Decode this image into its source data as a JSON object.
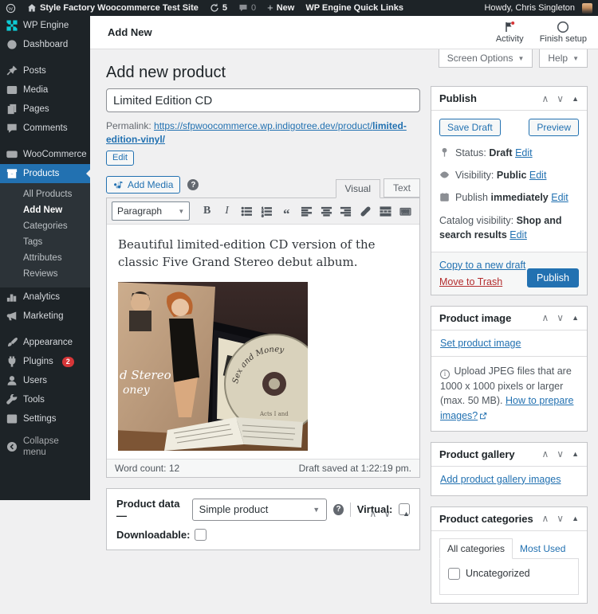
{
  "colors": {
    "accent": "#2271b1",
    "admin_bar_bg": "#1d2327",
    "badge_red": "#d63638",
    "danger_red": "#b32d2e",
    "wpengine_teal": "#0ecad4",
    "page_bg": "#f0f0f1"
  },
  "admin_bar": {
    "site_name": "Style Factory Woocommerce Test Site",
    "updates_count": "5",
    "comments_count": "0",
    "new_label": "New",
    "quick_links_label": "WP Engine Quick Links",
    "howdy_text": "Howdy, Chris Singleton"
  },
  "sidebar": {
    "wp_engine": "WP Engine",
    "dashboard": "Dashboard",
    "posts": "Posts",
    "media": "Media",
    "pages": "Pages",
    "comments": "Comments",
    "woocommerce": "WooCommerce",
    "products": "Products",
    "submenu": [
      "All Products",
      "Add New",
      "Categories",
      "Tags",
      "Attributes",
      "Reviews"
    ],
    "analytics": "Analytics",
    "marketing": "Marketing",
    "appearance": "Appearance",
    "plugins": "Plugins",
    "plugins_badge": "2",
    "users": "Users",
    "tools": "Tools",
    "settings": "Settings",
    "collapse": "Collapse menu"
  },
  "header": {
    "page_title": "Add New",
    "activity_label": "Activity",
    "finish_setup_label": "Finish setup",
    "screen_options_label": "Screen Options",
    "help_label": "Help"
  },
  "main": {
    "heading": "Add new product",
    "title_value": "Limited Edition CD",
    "permalink": {
      "label": "Permalink:",
      "url_base": "https://sfpwoocommerce.wp.indigotree.dev/product/",
      "slug": "limited-edition-vinyl/",
      "edit_button": "Edit"
    },
    "editor": {
      "add_media_label": "Add Media",
      "visual_tab": "Visual",
      "text_tab": "Text",
      "paragraph_label": "Paragraph",
      "content_text": "Beautiful limited-edition CD version of the classic Five Grand Stereo debut album.",
      "word_count_label": "Word count:",
      "word_count_value": "12",
      "draft_saved_text": "Draft saved at 1:22:19 pm."
    },
    "product_data": {
      "title": "Product data —",
      "type_selected": "Simple product",
      "virtual_label": "Virtual:",
      "downloadable_label": "Downloadable:"
    }
  },
  "publish_box": {
    "title": "Publish",
    "save_draft": "Save Draft",
    "preview": "Preview",
    "status_label": "Status:",
    "status_value": "Draft",
    "visibility_label": "Visibility:",
    "visibility_value": "Public",
    "publish_label": "Publish",
    "publish_value": "immediately",
    "catalog_label": "Catalog visibility:",
    "catalog_value": "Shop and search results",
    "edit_link": "Edit",
    "copy_draft_link": "Copy to a new draft",
    "trash_link": "Move to Trash",
    "publish_button": "Publish"
  },
  "product_image_box": {
    "title": "Product image",
    "set_image_link": "Set product image",
    "info_text": "Upload JPEG files that are 1000 x 1000 pixels or larger (max. 50 MB).",
    "info_link": "How to prepare images?"
  },
  "product_gallery_box": {
    "title": "Product gallery",
    "add_link": "Add product gallery images"
  },
  "product_categories_box": {
    "title": "Product categories",
    "tab_all": "All categories",
    "tab_most_used": "Most Used",
    "category_item": "Uncategorized"
  }
}
